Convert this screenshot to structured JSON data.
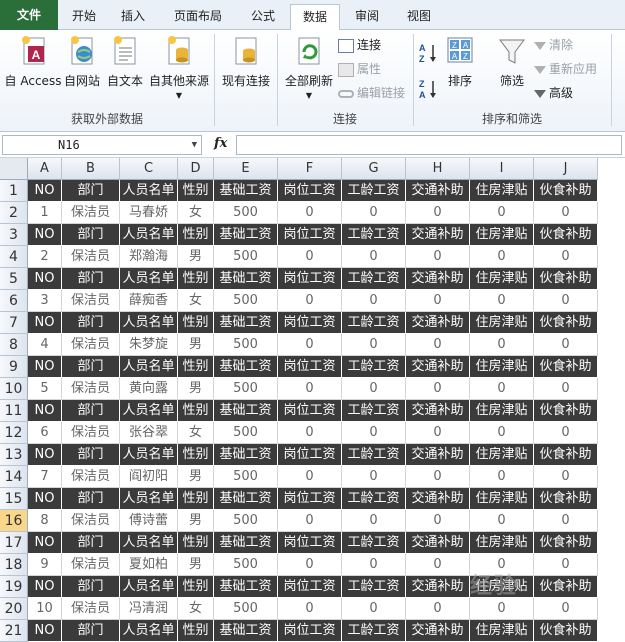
{
  "ribbon_tabs": [
    "文件",
    "开始",
    "插入",
    "页面布局",
    "公式",
    "数据",
    "审阅",
    "视图"
  ],
  "active_tab": "数据",
  "groups": {
    "external": {
      "name": "获取外部数据",
      "buttons": [
        "自 Access",
        "自网站",
        "自文本",
        "自其他来源"
      ]
    },
    "existing": {
      "label": "现有连接"
    },
    "connections": {
      "name": "连接",
      "refresh": "全部刷新",
      "small": [
        "连接",
        "属性",
        "编辑链接"
      ]
    },
    "sort_filter": {
      "name": "排序和筛选",
      "sort": "排序",
      "filter": "筛选",
      "small": [
        "清除",
        "重新应用",
        "高级"
      ]
    }
  },
  "formula_bar": {
    "name_box": "N16",
    "fx": "fx",
    "content": ""
  },
  "columns": [
    "A",
    "B",
    "C",
    "D",
    "E",
    "F",
    "G",
    "H",
    "I",
    "J"
  ],
  "rows": [
    "1",
    "2",
    "3",
    "4",
    "5",
    "6",
    "7",
    "8",
    "9",
    "10",
    "11",
    "12",
    "13",
    "14",
    "15",
    "16",
    "17",
    "18",
    "19",
    "20",
    "21"
  ],
  "selected_row": "16",
  "header_row": [
    "NO",
    "部门",
    "人员名单",
    "性别",
    "基础工资",
    "岗位工资",
    "工龄工资",
    "交通补助",
    "住房津贴",
    "伙食补助"
  ],
  "records": [
    [
      "1",
      "保洁员",
      "马春娇",
      "女",
      "500",
      "0",
      "0",
      "0",
      "0",
      "0"
    ],
    [
      "2",
      "保洁员",
      "郑瀚海",
      "男",
      "500",
      "0",
      "0",
      "0",
      "0",
      "0"
    ],
    [
      "3",
      "保洁员",
      "薛痴香",
      "女",
      "500",
      "0",
      "0",
      "0",
      "0",
      "0"
    ],
    [
      "4",
      "保洁员",
      "朱梦旋",
      "男",
      "500",
      "0",
      "0",
      "0",
      "0",
      "0"
    ],
    [
      "5",
      "保洁员",
      "黄向露",
      "男",
      "500",
      "0",
      "0",
      "0",
      "0",
      "0"
    ],
    [
      "6",
      "保洁员",
      "张谷翠",
      "女",
      "500",
      "0",
      "0",
      "0",
      "0",
      "0"
    ],
    [
      "7",
      "保洁员",
      "阎初阳",
      "男",
      "500",
      "0",
      "0",
      "0",
      "0",
      "0"
    ],
    [
      "8",
      "保洁员",
      "傅诗蕾",
      "男",
      "500",
      "0",
      "0",
      "0",
      "0",
      "0"
    ],
    [
      "9",
      "保洁员",
      "夏如柏",
      "男",
      "500",
      "0",
      "0",
      "0",
      "0",
      "0"
    ],
    [
      "10",
      "保洁员",
      "冯清润",
      "女",
      "500",
      "0",
      "0",
      "0",
      "0",
      "0"
    ]
  ],
  "watermark": "经验"
}
